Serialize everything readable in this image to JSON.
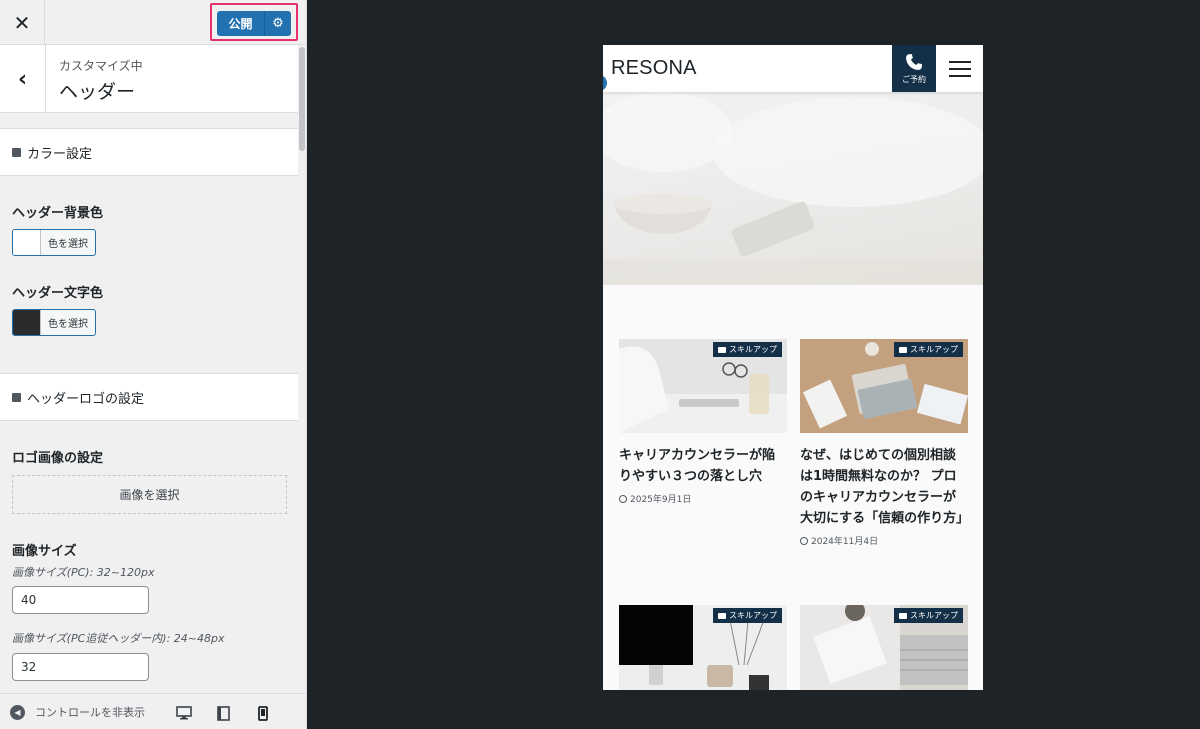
{
  "customizer": {
    "close_icon": "close-icon",
    "publish_label": "公開",
    "publish_gear_icon": "gear-icon",
    "customizing_label": "カスタマイズ中",
    "section_title": "ヘッダー",
    "groups": {
      "color": {
        "title": "カラー設定"
      },
      "logo": {
        "title": "ヘッダーロゴの設定"
      }
    },
    "controls": {
      "bg_color_label": "ヘッダー背景色",
      "bg_color_value": "#ffffff",
      "text_color_label": "ヘッダー文字色",
      "text_color_value": "#2b2b2b",
      "select_color_label": "色を選択",
      "logo_image_label": "ロゴ画像の設定",
      "select_image_label": "画像を選択",
      "image_size_label": "画像サイズ",
      "pc_size_desc": "画像サイズ(PC): 32~120px",
      "pc_size_value": "40",
      "sticky_size_desc": "画像サイズ(PC追従ヘッダー内): 24~48px",
      "sticky_size_value": "32"
    },
    "footer": {
      "hide_controls_label": "コントロールを非表示",
      "devices": [
        "desktop-icon",
        "tablet-icon",
        "mobile-icon"
      ]
    }
  },
  "preview": {
    "logo": "RESONA",
    "reserve_label": "ご予約",
    "posts": [
      {
        "category": "スキルアップ",
        "title": "キャリアカウンセラーが陥りやすい３つの落とし穴",
        "date": "2025年9月1日"
      },
      {
        "category": "スキルアップ",
        "title": "なぜ、はじめての個別相談は1時間無料なのか？ プロのキャリアカウンセラーが大切にする「信頼の作り方」",
        "date": "2024年11月4日"
      },
      {
        "category": "スキルアップ",
        "title": "",
        "date": ""
      },
      {
        "category": "スキルアップ",
        "title": "",
        "date": ""
      }
    ]
  },
  "colors": {
    "accent": "#2271b1",
    "highlight": "#e6306d",
    "brand_navy": "#143049"
  }
}
